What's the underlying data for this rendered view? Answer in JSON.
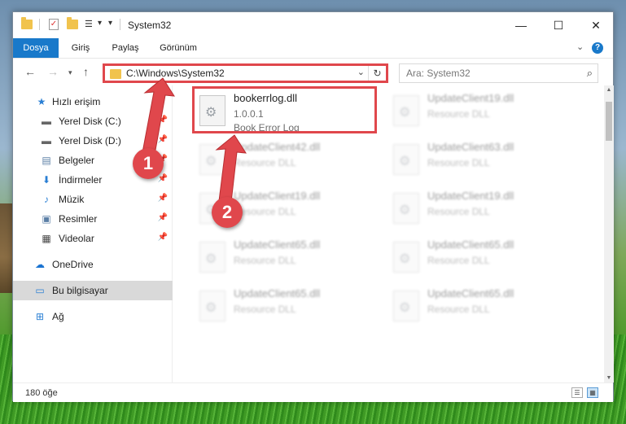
{
  "window": {
    "title": "System32",
    "controls": {
      "minimize": "—",
      "maximize": "☐",
      "close": "✕"
    }
  },
  "ribbon": {
    "tabs": [
      "Dosya",
      "Giriş",
      "Paylaş",
      "Görünüm"
    ],
    "active_tab": "Dosya",
    "accent_color": "#1979ca"
  },
  "navbar": {
    "address": "C:\\Windows\\System32",
    "search_placeholder": "Ara: System32"
  },
  "sidebar": {
    "items": [
      {
        "label": "Hızlı erişim",
        "icon": "star-icon",
        "pinned": false
      },
      {
        "label": "Yerel Disk (C:)",
        "icon": "drive-icon",
        "pinned": true
      },
      {
        "label": "Yerel Disk (D:)",
        "icon": "drive-icon",
        "pinned": true
      },
      {
        "label": "Belgeler",
        "icon": "documents-icon",
        "pinned": true
      },
      {
        "label": "İndirmeler",
        "icon": "downloads-icon",
        "pinned": true
      },
      {
        "label": "Müzik",
        "icon": "music-icon",
        "pinned": true
      },
      {
        "label": "Resimler",
        "icon": "pictures-icon",
        "pinned": true
      },
      {
        "label": "Videolar",
        "icon": "videos-icon",
        "pinned": true
      },
      {
        "label": "OneDrive",
        "icon": "onedrive-icon",
        "pinned": false
      },
      {
        "label": "Bu bilgisayar",
        "icon": "computer-icon",
        "pinned": false,
        "selected": true
      },
      {
        "label": "Ağ",
        "icon": "network-icon",
        "pinned": false
      }
    ]
  },
  "files": {
    "highlighted": {
      "name": "bookerrlog.dll",
      "version": "1.0.0.1",
      "description": "Book Error Log"
    },
    "background": [
      {
        "name": "UpdateClient19.dll",
        "type": "Resource DLL"
      },
      {
        "name": "UpdateClient42.dll",
        "type": "Resource DLL"
      },
      {
        "name": "UpdateClient63.dll",
        "type": "Resource DLL"
      },
      {
        "name": "UpdateClient19.dll",
        "type": "Resource DLL"
      },
      {
        "name": "UpdateClient19.dll",
        "type": "Resource DLL"
      },
      {
        "name": "UpdateClient65.dll",
        "type": "Resource DLL"
      },
      {
        "name": "UpdateClient65.dll",
        "type": "Resource DLL"
      },
      {
        "name": "UpdateClient65.dll",
        "type": "Resource DLL"
      },
      {
        "name": "UpdateClient65.dll",
        "type": "Resource DLL"
      }
    ]
  },
  "status": {
    "item_count": "180 öğe"
  },
  "annotations": {
    "marker1": "1",
    "marker2": "2",
    "color": "#e0474c"
  }
}
